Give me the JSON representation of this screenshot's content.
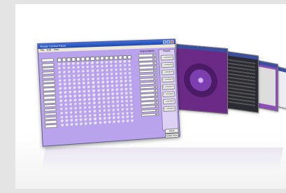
{
  "main_window": {
    "title": "Router Control Panel",
    "menu": [
      "File",
      "Edit",
      "View"
    ],
    "outputs_header": "Output Names",
    "presets_header": "Presets",
    "preset_buttons": [
      "1 - unassigned -",
      "2 - unassigned -",
      "3 - unassigned -",
      "4 - unassigned -",
      "5 - unassigned -",
      "6 - unassigned -",
      "7 - unassigned -",
      "8 - unassigned -"
    ],
    "recall_label": "Recall",
    "update_label": "Update Preset"
  },
  "colors": {
    "accent": "#b9a3ec",
    "titlebar": "#2047a8",
    "background": "#e4e4e4"
  },
  "icons": [
    "minimize-icon",
    "maximize-icon",
    "close-icon"
  ]
}
